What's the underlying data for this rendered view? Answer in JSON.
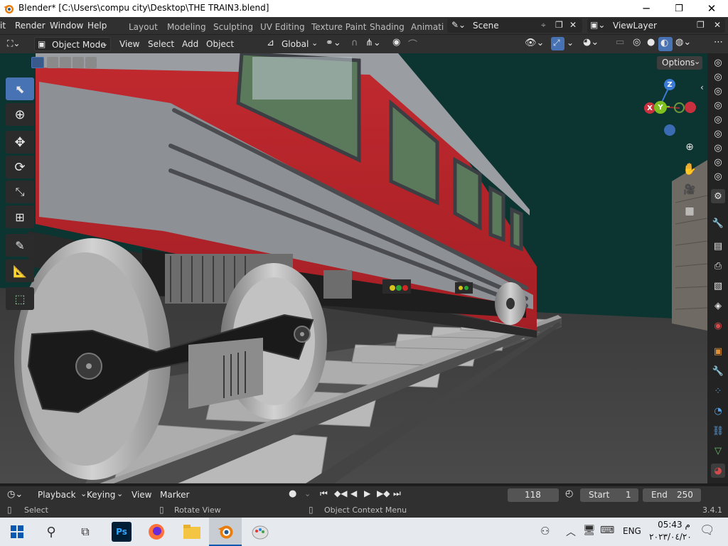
{
  "window": {
    "title": "Blender* [C:\\Users\\compu city\\Desktop\\THE TRAIN3.blend]",
    "minimize": "─",
    "maximize": "❐",
    "close": "✕"
  },
  "menubar": {
    "items": [
      "it",
      "Render",
      "Window",
      "Help"
    ],
    "workspaces": [
      "Layout",
      "Modeling",
      "Sculpting",
      "UV Editing",
      "Texture Paint",
      "Shading",
      "Animati"
    ],
    "scene": "Scene",
    "view_layer": "ViewLayer"
  },
  "header3d": {
    "mode": "Object Mode",
    "menus": [
      "View",
      "Select",
      "Add",
      "Object"
    ],
    "orientation": "Global",
    "options": "Options"
  },
  "gizmo": {
    "x": "X",
    "y": "Y",
    "z": "Z"
  },
  "timeline": {
    "menus": [
      "Playback",
      "Keying",
      "View",
      "Marker"
    ],
    "current_frame": "118",
    "start_label": "Start",
    "start": "1",
    "end_label": "End",
    "end": "250"
  },
  "statusbar": {
    "select": "Select",
    "rotate": "Rotate View",
    "context": "Object Context Menu",
    "version": "3.4.1"
  },
  "taskbar": {
    "lang": "ENG",
    "time": "05:43 م",
    "date": "٢٠٢٣/٠٤/٢٠"
  },
  "colors": {
    "accent": "#4772b3",
    "train_red": "#c8242c",
    "background_teal": "#0c3431"
  }
}
